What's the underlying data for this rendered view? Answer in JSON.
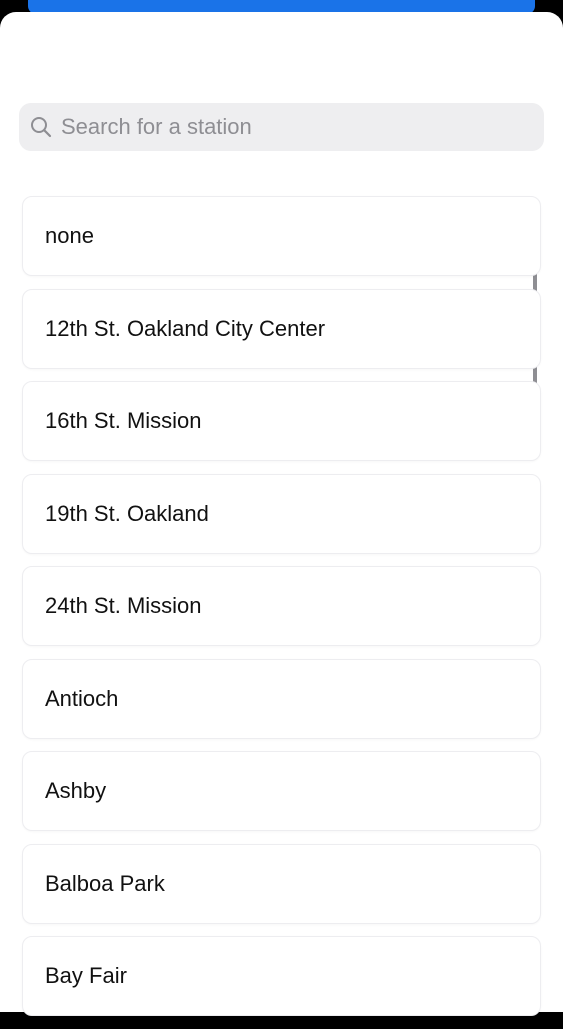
{
  "search": {
    "placeholder": "Search for a station",
    "value": ""
  },
  "stations": [
    {
      "label": "none"
    },
    {
      "label": "12th St. Oakland City Center"
    },
    {
      "label": "16th St. Mission"
    },
    {
      "label": "19th St. Oakland"
    },
    {
      "label": "24th St. Mission"
    },
    {
      "label": "Antioch"
    },
    {
      "label": "Ashby"
    },
    {
      "label": "Balboa Park"
    },
    {
      "label": "Bay Fair"
    }
  ],
  "colors": {
    "backdrop_accent": "#1a73e8",
    "search_background": "#eeeef0",
    "placeholder": "#8e8e93"
  },
  "icons": {
    "search": "search-icon"
  }
}
